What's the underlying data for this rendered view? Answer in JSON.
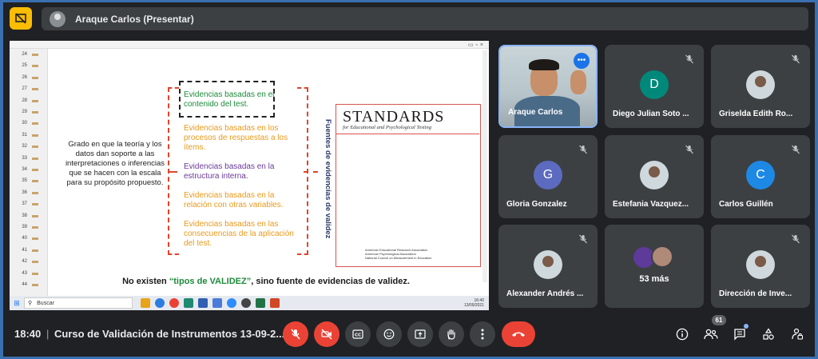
{
  "presenter_bar": {
    "label": "Araque Carlos (Presentar)"
  },
  "shared_screen": {
    "slide_numbers": [
      "24",
      "25",
      "26",
      "27",
      "28",
      "29",
      "30",
      "31",
      "32",
      "33",
      "34",
      "35",
      "36",
      "37",
      "38",
      "39",
      "40",
      "41",
      "42",
      "43",
      "44"
    ],
    "left_text": "Grado en que la teoría y los datos dan soporte a las interpretaciones o inferencias que se hacen con la escala para su propósito propuesto.",
    "evidences": [
      "Evidencias basadas en el contenido del test.",
      "Evidencias basadas en los procesos de respuestas a los ítems.",
      "Evidencias basadas en la estructura interna.",
      "Evidencias basadas en la relación con otras variables.",
      "Evidencias basadas en las consecuencias de la aplicación del test."
    ],
    "vertical_label": "Fuentes de evidencias de validez",
    "book_title": "STANDARDS",
    "book_subtitle": "for Educational and Psychological Testing",
    "book_publishers": [
      "American Educational Research Association",
      "American Psychological Association",
      "National Council on Measurement in Education"
    ],
    "bottom_prefix": "No existen ",
    "bottom_highlight": "“tipos de VALIDEZ”",
    "bottom_suffix": ", sino fuente de evidencias de validez.",
    "taskbar_search": "Buscar",
    "taskbar_time": "16:40",
    "taskbar_date": "13/09/2021"
  },
  "participants": [
    {
      "name": "Araque Carlos",
      "type": "video",
      "speaking": true
    },
    {
      "name": "Diego Julian Soto ...",
      "initial": "D",
      "color": "#00897b",
      "muted": true
    },
    {
      "name": "Griselda Edith Ro...",
      "type": "photo",
      "muted": true
    },
    {
      "name": "Gloria Gonzalez",
      "initial": "G",
      "color": "#5c6bc0",
      "muted": true
    },
    {
      "name": "Estefania Vazquez...",
      "type": "photo",
      "muted": true
    },
    {
      "name": "Carlos Guillén",
      "initial": "C",
      "color": "#1e88e5",
      "muted": true
    },
    {
      "name": "Alexander Andrés ...",
      "type": "photo",
      "muted": true
    },
    {
      "name": "53 más",
      "type": "more"
    },
    {
      "name": "Dirección de Inve...",
      "type": "photo",
      "muted": true
    }
  ],
  "bottom_bar": {
    "time": "18:40",
    "separator": "|",
    "meeting_title": "Curso de Validación de Instrumentos 13-09-2...",
    "participant_count": "61"
  },
  "colors": {
    "background": "#202124",
    "tile": "#3c4043",
    "danger": "#ea4335",
    "accent": "#fbbc04"
  }
}
